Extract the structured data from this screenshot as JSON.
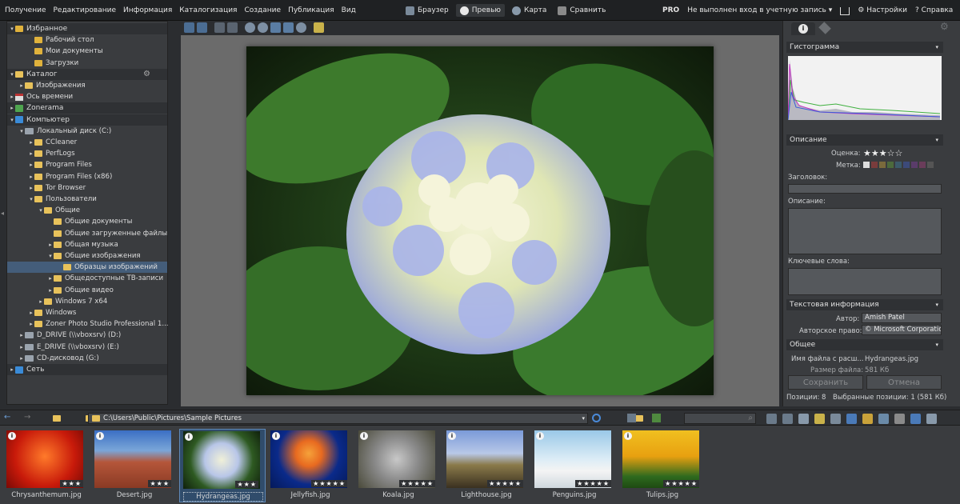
{
  "menu": [
    "Получение",
    "Редактирование",
    "Информация",
    "Каталогизация",
    "Создание",
    "Публикация",
    "Вид"
  ],
  "modes": [
    {
      "label": "Браузер",
      "icon": "browser-icon",
      "active": false
    },
    {
      "label": "Превью",
      "icon": "preview-icon",
      "active": true
    },
    {
      "label": "Карта",
      "icon": "map-icon",
      "active": false
    },
    {
      "label": "Сравнить",
      "icon": "compare-icon",
      "active": false
    }
  ],
  "topright": {
    "pro": "PRO",
    "login": "Не выполнен вход в учетную запись",
    "login_chev": "▾",
    "cart": "🛒",
    "settings": "Настройки",
    "help": "Справка"
  },
  "tree": [
    {
      "label": "Избранное",
      "level": 0,
      "type": "header",
      "icon": "star",
      "arrow": "▾"
    },
    {
      "label": "Рабочий стол",
      "level": 2,
      "icon": "star"
    },
    {
      "label": "Мои документы",
      "level": 2,
      "icon": "star"
    },
    {
      "label": "Загрузки",
      "level": 2,
      "icon": "star"
    },
    {
      "label": "Каталог",
      "level": 0,
      "type": "header",
      "icon": "folder",
      "arrow": "▾"
    },
    {
      "label": "Изображения",
      "level": 1,
      "icon": "folder",
      "arrow": "▸"
    },
    {
      "label": "Ось времени",
      "level": 0,
      "icon": "cal",
      "arrow": "▸"
    },
    {
      "label": "Zonerama",
      "level": 0,
      "type": "header",
      "icon": "green",
      "arrow": "▸"
    },
    {
      "label": "Компьютер",
      "level": 0,
      "type": "header",
      "icon": "blue",
      "arrow": "▾"
    },
    {
      "label": "Локальный диск (C:)",
      "level": 1,
      "icon": "drive",
      "arrow": "▾"
    },
    {
      "label": "CCleaner",
      "level": 2,
      "icon": "folder",
      "arrow": "▸"
    },
    {
      "label": "PerfLogs",
      "level": 2,
      "icon": "folder",
      "arrow": "▸"
    },
    {
      "label": "Program Files",
      "level": 2,
      "icon": "folder",
      "arrow": "▸"
    },
    {
      "label": "Program Files (x86)",
      "level": 2,
      "icon": "folder",
      "arrow": "▸"
    },
    {
      "label": "Tor Browser",
      "level": 2,
      "icon": "folder",
      "arrow": "▸"
    },
    {
      "label": "Пользователи",
      "level": 2,
      "icon": "folder",
      "arrow": "▾"
    },
    {
      "label": "Общие",
      "level": 3,
      "icon": "folder",
      "arrow": "▾"
    },
    {
      "label": "Общие документы",
      "level": 4,
      "icon": "folder"
    },
    {
      "label": "Общие загруженные файлы",
      "level": 4,
      "icon": "folder"
    },
    {
      "label": "Общая музыка",
      "level": 4,
      "icon": "folder",
      "arrow": "▸"
    },
    {
      "label": "Общие изображения",
      "level": 4,
      "icon": "folder",
      "arrow": "▾"
    },
    {
      "label": "Образцы изображений",
      "level": 5,
      "icon": "folder",
      "selected": true
    },
    {
      "label": "Общедоступные ТВ-записи",
      "level": 4,
      "icon": "folder",
      "arrow": "▸"
    },
    {
      "label": "Общие видео",
      "level": 4,
      "icon": "folder",
      "arrow": "▸"
    },
    {
      "label": "Windows 7 x64",
      "level": 3,
      "icon": "folder",
      "arrow": "▸"
    },
    {
      "label": "Windows",
      "level": 2,
      "icon": "folder",
      "arrow": "▸"
    },
    {
      "label": "Zoner Photo Studio Professional 1...",
      "level": 2,
      "icon": "folder",
      "arrow": "▸"
    },
    {
      "label": "D_DRIVE (\\\\vboxsrv) (D:)",
      "level": 1,
      "icon": "drive",
      "arrow": "▸"
    },
    {
      "label": "E_DRIVE (\\\\vboxsrv) (E:)",
      "level": 1,
      "icon": "drive",
      "arrow": "▸"
    },
    {
      "label": "CD-дисковод (G:)",
      "level": 1,
      "icon": "drive",
      "arrow": "▸"
    },
    {
      "label": "Сеть",
      "level": 0,
      "type": "header",
      "icon": "blue",
      "arrow": "▸"
    }
  ],
  "right": {
    "histogram_title": "Гистограмма",
    "description_title": "Описание",
    "rating_label": "Оценка:",
    "rating_stars": "★★★☆☆",
    "label_label": "Метка:",
    "heading_label": "Заголовок:",
    "desc_label": "Описание:",
    "keywords_label": "Ключевые слова:",
    "text_info_title": "Текстовая информация",
    "author_label": "Автор:",
    "author_value": "Amish Patel",
    "copyright_label": "Авторское право:",
    "copyright_value": "© Microsoft Corporatio",
    "general_title": "Общее",
    "filename_label": "Имя файла с расш...",
    "filename_value": "Hydrangeas.jpg",
    "filesize_label": "Размер файла:",
    "filesize_value": "581 Кб",
    "save": "Сохранить",
    "cancel": "Отмена",
    "positions": "Позиции: 8",
    "selected_positions": "Выбранные позиции: 1 (581 Кб)"
  },
  "path": "C:\\Users\\Public\\Pictures\\Sample Pictures",
  "thumbnails": [
    {
      "name": "Chrysanthemum.jpg",
      "stars": "★★★",
      "selected": false
    },
    {
      "name": "Desert.jpg",
      "stars": "★★★",
      "selected": false
    },
    {
      "name": "Hydrangeas.jpg",
      "stars": "★★★",
      "selected": true
    },
    {
      "name": "Jellyfish.jpg",
      "stars": "★★★★★",
      "selected": false
    },
    {
      "name": "Koala.jpg",
      "stars": "★★★★★",
      "selected": false
    },
    {
      "name": "Lighthouse.jpg",
      "stars": "★★★★★",
      "selected": false
    },
    {
      "name": "Penguins.jpg",
      "stars": "★★★★★",
      "selected": false
    },
    {
      "name": "Tulips.jpg",
      "stars": "★★★★★",
      "selected": false
    }
  ],
  "colors": {
    "accent": "#445d7a",
    "selection": "#304c6b"
  }
}
